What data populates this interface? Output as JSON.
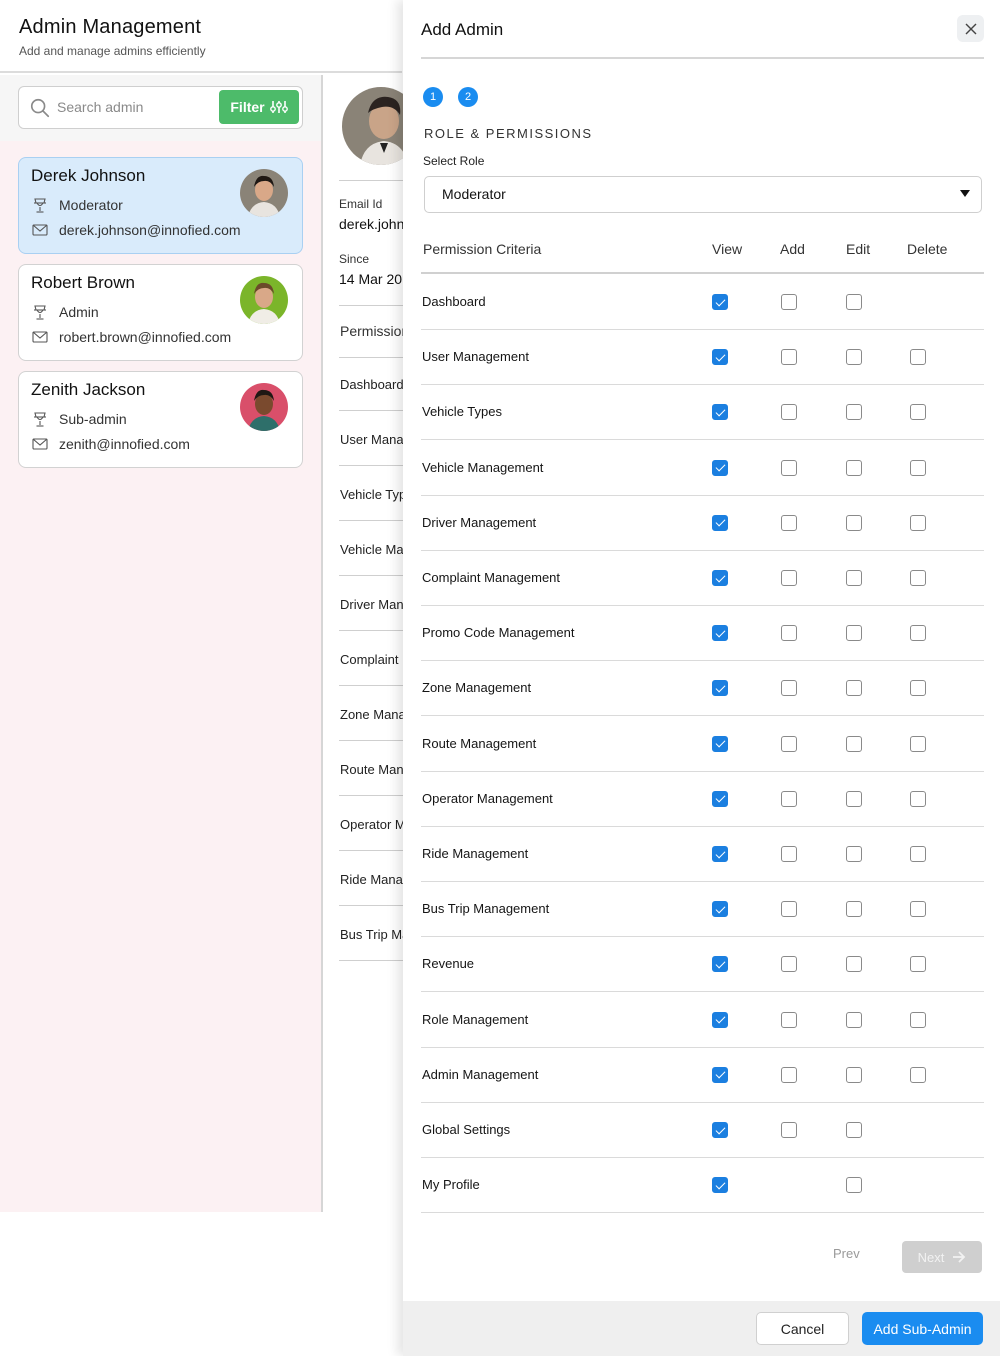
{
  "page": {
    "title": "Admin Management",
    "subtitle": "Add and manage admins efficiently"
  },
  "search": {
    "placeholder": "Search admin",
    "value": "",
    "filter_label": "Filter"
  },
  "admins": [
    {
      "name": "Derek Johnson",
      "role": "Moderator",
      "email": "derek.johnson@innofied.com",
      "selected": true,
      "avatar_bg": "#8a8377"
    },
    {
      "name": "Robert Brown",
      "role": "Admin",
      "email": "robert.brown@innofied.com",
      "selected": false,
      "avatar_bg": "#7bb52a"
    },
    {
      "name": "Zenith Jackson",
      "role": "Sub-admin",
      "email": "zenith@innofied.com",
      "selected": false,
      "avatar_bg": "#d94f6a"
    }
  ],
  "detail": {
    "email_label": "Email Id",
    "email_value": "derek.johnson@innofied.com",
    "since_label": "Since",
    "since_value": "14 Mar 20",
    "permissions_heading": "Permissions",
    "permission_items": [
      "Dashboard",
      "User Management",
      "Vehicle Types",
      "Vehicle Management",
      "Driver Management",
      "Complaint Management",
      "Zone Management",
      "Route Management",
      "Operator Management",
      "Ride Management",
      "Bus Trip Management"
    ]
  },
  "drawer": {
    "title": "Add Admin",
    "steps": [
      "1",
      "2"
    ],
    "section_title": "ROLE & PERMISSIONS",
    "select_role_label": "Select Role",
    "selected_role": "Moderator",
    "columns": {
      "criteria": "Permission Criteria",
      "view": "View",
      "add": "Add",
      "edit": "Edit",
      "delete": "Delete"
    },
    "permissions": [
      {
        "name": "Dashboard",
        "view": true,
        "add": false,
        "edit": false,
        "delete": null
      },
      {
        "name": "User Management",
        "view": true,
        "add": false,
        "edit": false,
        "delete": false
      },
      {
        "name": "Vehicle Types",
        "view": true,
        "add": false,
        "edit": false,
        "delete": false
      },
      {
        "name": "Vehicle Management",
        "view": true,
        "add": false,
        "edit": false,
        "delete": false
      },
      {
        "name": "Driver Management",
        "view": true,
        "add": false,
        "edit": false,
        "delete": false
      },
      {
        "name": "Complaint Management",
        "view": true,
        "add": false,
        "edit": false,
        "delete": false
      },
      {
        "name": "Promo Code Management",
        "view": true,
        "add": false,
        "edit": false,
        "delete": false
      },
      {
        "name": "Zone Management",
        "view": true,
        "add": false,
        "edit": false,
        "delete": false
      },
      {
        "name": "Route Management",
        "view": true,
        "add": false,
        "edit": false,
        "delete": false
      },
      {
        "name": "Operator Management",
        "view": true,
        "add": false,
        "edit": false,
        "delete": false
      },
      {
        "name": "Ride Management",
        "view": true,
        "add": false,
        "edit": false,
        "delete": false
      },
      {
        "name": "Bus Trip Management",
        "view": true,
        "add": false,
        "edit": false,
        "delete": false
      },
      {
        "name": "Revenue",
        "view": true,
        "add": false,
        "edit": false,
        "delete": false
      },
      {
        "name": "Role Management",
        "view": true,
        "add": false,
        "edit": false,
        "delete": false
      },
      {
        "name": "Admin Management",
        "view": true,
        "add": false,
        "edit": false,
        "delete": false
      },
      {
        "name": "Global Settings",
        "view": true,
        "add": false,
        "edit": false,
        "delete": null
      },
      {
        "name": "My Profile",
        "view": true,
        "add": null,
        "edit": false,
        "delete": null
      }
    ],
    "prev_label": "Prev",
    "next_label": "Next",
    "cancel_label": "Cancel",
    "submit_label": "Add Sub-Admin"
  },
  "colors": {
    "accent": "#1a8cf0",
    "filter_green": "#4dbb6a",
    "selected_card": "#d9ebfb",
    "list_bg": "#fcf1f3"
  }
}
